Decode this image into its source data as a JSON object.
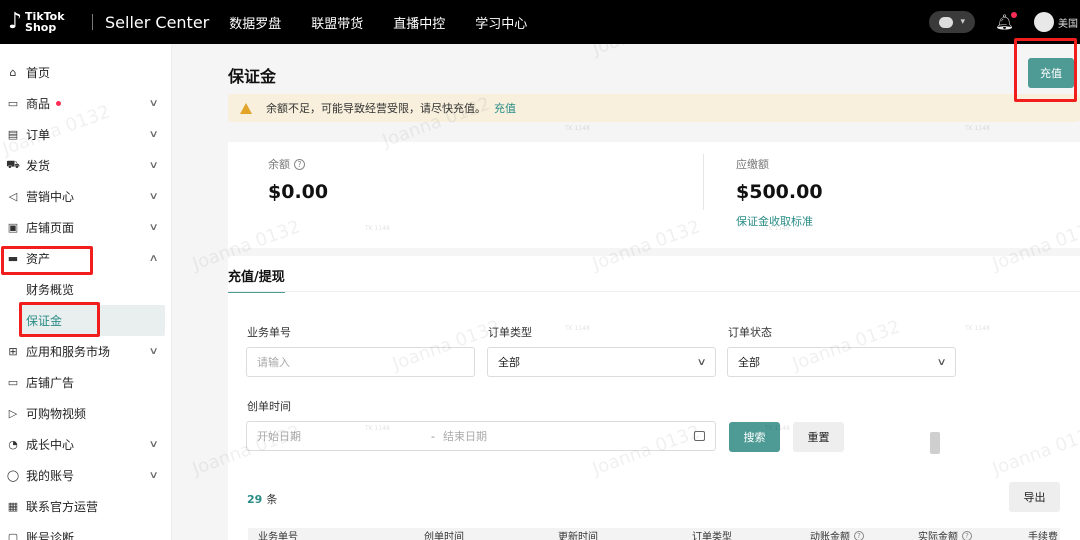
{
  "topbar": {
    "logo_top": "TikTok",
    "logo_bottom": "Shop",
    "brand": "Seller Center",
    "nav": [
      "数据罗盘",
      "联盟带货",
      "直播中控",
      "学习中心"
    ],
    "region": "美国"
  },
  "sidebar": {
    "items": [
      {
        "label": "首页",
        "icon": "home-icon"
      },
      {
        "label": "商品",
        "icon": "product-icon"
      },
      {
        "label": "订单",
        "icon": "order-icon"
      },
      {
        "label": "发货",
        "icon": "truck-icon"
      },
      {
        "label": "营销中心",
        "icon": "megaphone-icon"
      },
      {
        "label": "店铺页面",
        "icon": "store-icon"
      },
      {
        "label": "资产",
        "icon": "wallet-icon"
      },
      {
        "label": "应用和服务市场",
        "icon": "apps-icon"
      },
      {
        "label": "店铺广告",
        "icon": "ad-icon"
      },
      {
        "label": "可购物视频",
        "icon": "video-icon"
      },
      {
        "label": "成长中心",
        "icon": "growth-icon"
      },
      {
        "label": "我的账号",
        "icon": "account-icon"
      },
      {
        "label": "联系官方运营",
        "icon": "contact-icon"
      },
      {
        "label": "账号诊断",
        "icon": "diagnosis-icon"
      }
    ],
    "subitems": [
      "财务概览",
      "保证金"
    ]
  },
  "page": {
    "title": "保证金",
    "topup_button": "充值",
    "alert_text": "余额不足，可能导致经营受限，请尽快充值。",
    "alert_link": "充值"
  },
  "balance": {
    "balance_label": "余额",
    "balance_value": "$0.00",
    "due_label": "应缴额",
    "due_value": "$500.00",
    "standard_link": "保证金收取标准"
  },
  "records": {
    "tab": "充值/提现",
    "order_no_label": "业务单号",
    "order_no_placeholder": "请输入",
    "order_type_label": "订单类型",
    "order_type_value": "全部",
    "order_status_label": "订单状态",
    "order_status_value": "全部",
    "created_label": "创单时间",
    "start_placeholder": "开始日期",
    "date_separator": "-",
    "end_placeholder": "结束日期",
    "search_button": "搜索",
    "reset_button": "重置",
    "count_value": "29",
    "count_unit": "条",
    "export_button": "导出",
    "columns": [
      "业务单号",
      "创单时间",
      "更新时间",
      "订单类型",
      "动账金额",
      "实际金额",
      "手续费"
    ]
  },
  "watermark": {
    "text": "Joanna 0132",
    "small": "TK 1148"
  },
  "colors": {
    "topbar": "#000000",
    "accent": "#4e9b95",
    "link": "#2a8c87",
    "alert_bg": "#f8f0dd",
    "annotation": "#f21d1d"
  }
}
